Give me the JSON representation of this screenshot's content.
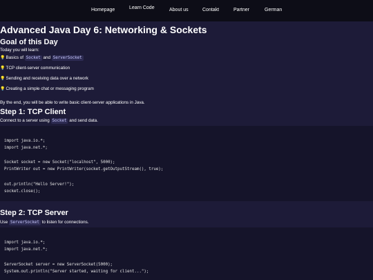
{
  "nav": {
    "items": [
      "Homepage",
      "Learn Code",
      "About us",
      "Contakt",
      "Partner",
      "German"
    ]
  },
  "page": {
    "title": "Advanced Java Day 6: Networking & Sockets",
    "goal": {
      "heading": "Goal of this Day",
      "intro": "Today you will learn:",
      "bullet1_a": "Basics of",
      "bullet1_code1": "Socket",
      "bullet1_and": "and",
      "bullet1_code2": "ServerSocket",
      "bullet2": "TCP client-server communication",
      "bullet3": "Sending and receiving data over a network",
      "bullet4": "Creating a simple chat or messaging program",
      "summary": "By the end, you will be able to write basic client-server applications in Java."
    },
    "step1": {
      "heading": "Step 1: TCP Client",
      "desc_a": "Connect to a server using",
      "desc_code": "Socket",
      "desc_b": "and send data.",
      "code": [
        "import java.io.*;",
        "import java.net.*;",
        "",
        "Socket socket = new Socket(\"localhost\", 5000);",
        "PrintWriter out = new PrintWriter(socket.getOutputStream(), true);",
        "",
        "out.println(\"Hello Server!\");",
        "socket.close();"
      ]
    },
    "step2": {
      "heading": "Step 2: TCP Server",
      "desc_a": "Use",
      "desc_code": "ServerSocket",
      "desc_b": "to listen for connections.",
      "code": [
        "import java.io.*;",
        "import java.net.*;",
        "",
        "ServerSocket server = new ServerSocket(5000);",
        "System.out.println(\"Server started, waiting for client...\");"
      ]
    }
  },
  "colors": {
    "background": "#1d1b38",
    "nav_background": "#0d0d17",
    "code_background": "#15142a",
    "inline_code_background": "#2d2b52",
    "bulb": "#f5c518"
  },
  "icons": {
    "bullet": "lightbulb-icon"
  }
}
